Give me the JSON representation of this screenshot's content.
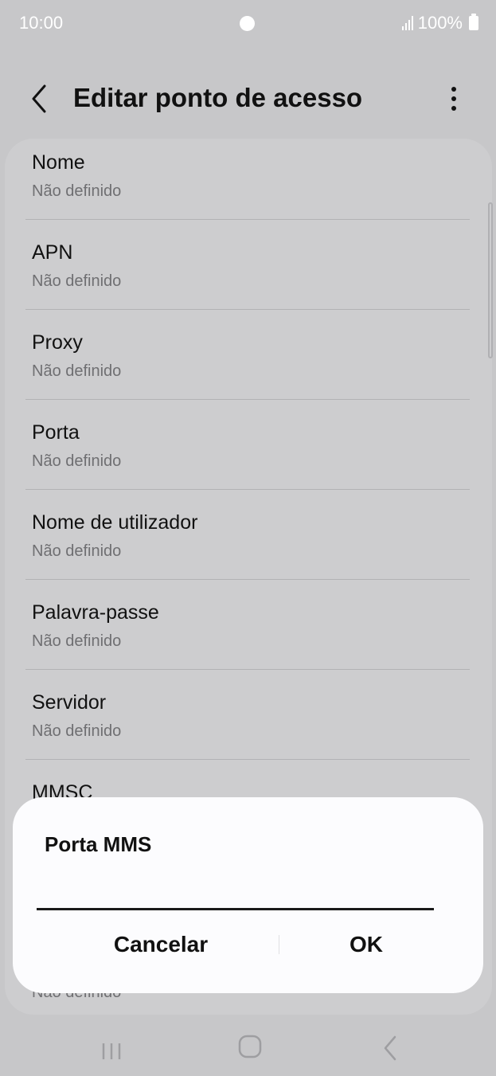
{
  "status_bar": {
    "time": "10:00",
    "battery_text": "100%"
  },
  "app_bar": {
    "title": "Editar ponto de acesso",
    "back_icon": "chevron-left-icon",
    "more_icon": "more-vertical-icon"
  },
  "settings": [
    {
      "title": "Nome",
      "value": "Não definido"
    },
    {
      "title": "APN",
      "value": "Não definido"
    },
    {
      "title": "Proxy",
      "value": "Não definido"
    },
    {
      "title": "Porta",
      "value": "Não definido"
    },
    {
      "title": "Nome de utilizador",
      "value": "Não definido"
    },
    {
      "title": "Palavra-passe",
      "value": "Não definido"
    },
    {
      "title": "Servidor",
      "value": "Não definido"
    },
    {
      "title": "MMSC",
      "value": ""
    }
  ],
  "trailing_value": "Não definido",
  "dialog": {
    "title": "Porta MMS",
    "input_value": "",
    "cancel_label": "Cancelar",
    "ok_label": "OK"
  },
  "nav_bar": {
    "recent_icon": "recent-apps-icon",
    "home_icon": "home-icon",
    "back_icon": "back-chevron-icon"
  },
  "colors": {
    "dim_background": "#c7c7c9",
    "dialog_background": "#fcfcfe",
    "text_primary": "#111111",
    "text_secondary": "#6f6f72"
  }
}
